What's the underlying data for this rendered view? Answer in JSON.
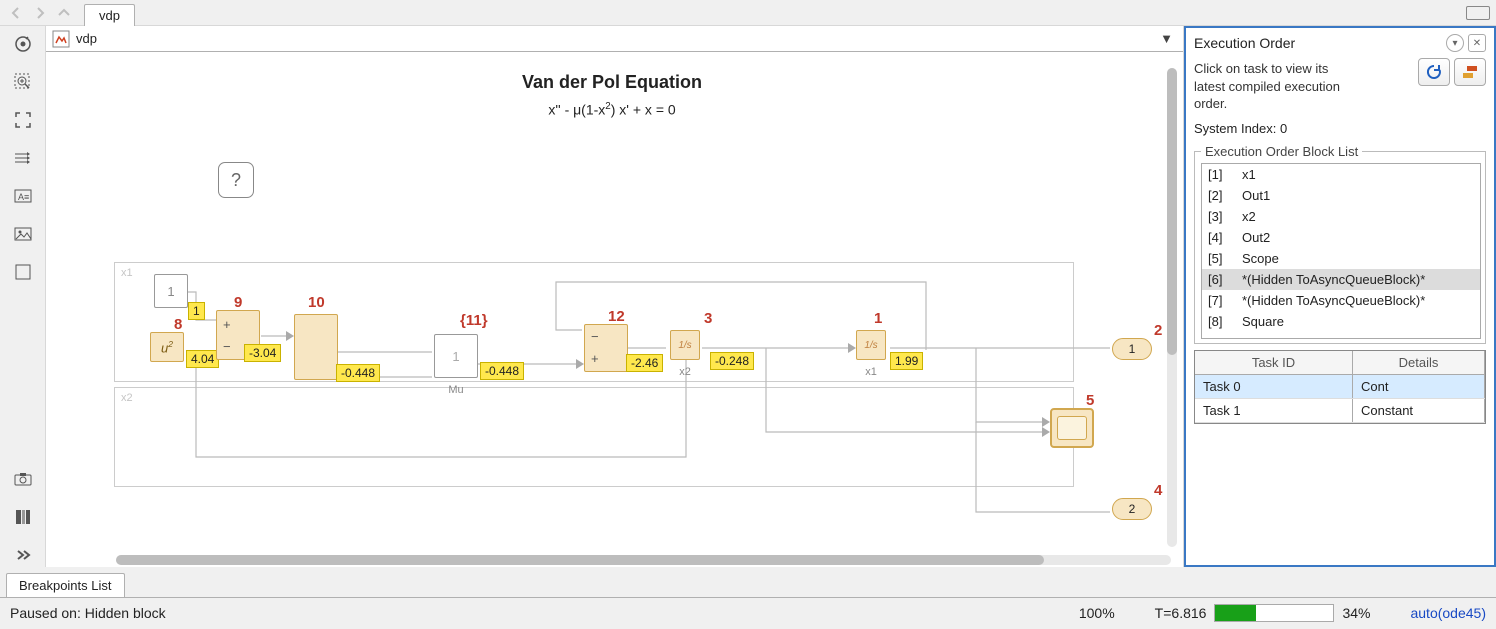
{
  "topbar": {
    "tab_label": "vdp"
  },
  "breadcrumb": {
    "model": "vdp"
  },
  "diagram": {
    "title": "Van der Pol Equation",
    "equation_plain": "x'' - μ(1-x²) x' + x = 0",
    "help_label": "?",
    "rails": {
      "x1": "x1",
      "x2": "x2"
    },
    "blocks": {
      "const1": "1",
      "square_sym": "u²",
      "mu_val": "1",
      "mu_label": "Mu",
      "x1_label": "x1",
      "x2_label": "x2",
      "integ_sym": "1/s",
      "out1": "1",
      "out2": "2"
    },
    "exec_numbers": {
      "n1": "1",
      "n2": "2",
      "n3": "3",
      "n4": "4",
      "n5": "5",
      "n8": "8",
      "n9": "9",
      "n10": "10",
      "n11": "{11}",
      "n12": "12"
    },
    "values": {
      "v1": "1",
      "v404": "4.04",
      "vneg304": "-3.04",
      "vneg0448a": "-0.448",
      "vmuout": "-0.448",
      "vneg246": "-2.46",
      "vneg0248": "-0.248",
      "v199": "1.99"
    }
  },
  "exec_panel": {
    "title": "Execution Order",
    "desc": "Click on task to view its\nlatest compiled execution\norder.",
    "system_index_label": "System Index:",
    "system_index_value": "0",
    "list_legend": "Execution Order Block List",
    "items": [
      {
        "idx": "[1]",
        "name": "x1"
      },
      {
        "idx": "[2]",
        "name": "Out1"
      },
      {
        "idx": "[3]",
        "name": "x2"
      },
      {
        "idx": "[4]",
        "name": "Out2"
      },
      {
        "idx": "[5]",
        "name": "Scope"
      },
      {
        "idx": "[6]",
        "name": "*(Hidden ToAsyncQueueBlock)*",
        "sel": true
      },
      {
        "idx": "[7]",
        "name": "*(Hidden ToAsyncQueueBlock)*"
      },
      {
        "idx": "[8]",
        "name": "Square"
      }
    ],
    "task_headers": {
      "c1": "Task ID",
      "c2": "Details"
    },
    "tasks": [
      {
        "id": "Task 0",
        "details": "Cont",
        "sel": true
      },
      {
        "id": "Task 1",
        "details": "Constant"
      }
    ]
  },
  "bottom": {
    "breakpoints_tab": "Breakpoints List",
    "paused": "Paused on: Hidden block",
    "zoom": "100%",
    "time_label": "T=",
    "time_value": "6.816",
    "progress_pct": 34,
    "progress_text": "34%",
    "solver": "auto(ode45)"
  }
}
